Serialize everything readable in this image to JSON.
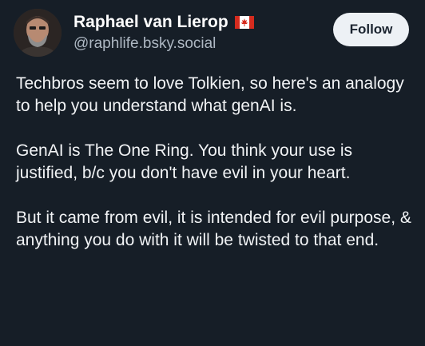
{
  "author": {
    "display_name": "Raphael van Lierop",
    "handle": "@raphlife.bsky.social",
    "flag_icon": "canada-flag-icon",
    "avatar_icon": "avatar-photo"
  },
  "actions": {
    "follow_label": "Follow"
  },
  "post": {
    "paragraphs": [
      "Techbros seem to love Tolkien, so here's an analogy to help you understand what genAI is.",
      "GenAI is The One Ring. You think your use is justified, b/c you don't have evil in your heart.",
      "But it came from evil, it is intended for evil purpose, & anything you do with it will be twisted to that end."
    ]
  },
  "colors": {
    "background": "#161e27",
    "text": "#f1f3f5",
    "handle": "#aeb8c3",
    "button_bg": "#edf1f5",
    "button_text": "#1b2430",
    "flag_red": "#d52b1e"
  }
}
